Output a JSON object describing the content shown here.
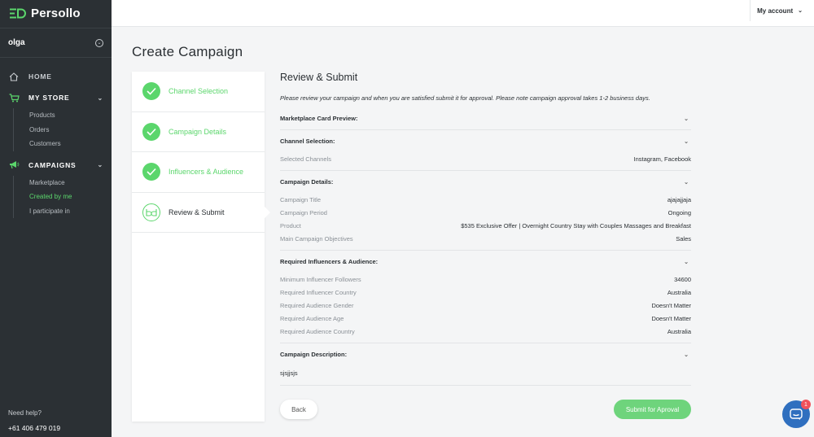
{
  "brand": {
    "name": "Persollo",
    "accent": "#5bd66c"
  },
  "user": {
    "name": "olga"
  },
  "nav": {
    "home": "HOME",
    "my_store": "MY STORE",
    "store_items": [
      "Products",
      "Orders",
      "Customers"
    ],
    "campaigns": "CAMPAIGNS",
    "campaign_items": [
      "Marketplace",
      "Created by me",
      "I participate in"
    ]
  },
  "help": {
    "label": "Need help?",
    "phone": "+61 406 479 019"
  },
  "topbar": {
    "account": "My account"
  },
  "page": {
    "title": "Create Campaign"
  },
  "steps": [
    {
      "label": "Channel Selection",
      "state": "done"
    },
    {
      "label": "Campaign Details",
      "state": "done"
    },
    {
      "label": "Influencers & Audience",
      "state": "done"
    },
    {
      "label": "Review & Submit",
      "state": "current"
    }
  ],
  "review": {
    "title": "Review & Submit",
    "instructions": "Please review your campaign and when you are satisfied submit it for approval. Please note campaign approval takes 1-2 business days.",
    "marketplace_preview": "Marketplace Card Preview:",
    "channel_selection": {
      "heading": "Channel Selection:",
      "rows": [
        {
          "label": "Selected Channels",
          "value": "Instagram, Facebook"
        }
      ]
    },
    "campaign_details": {
      "heading": "Campaign Details:",
      "rows": [
        {
          "label": "Campaign Title",
          "value": "ajajajjaja"
        },
        {
          "label": "Campaign Period",
          "value": "Ongoing"
        },
        {
          "label": "Product",
          "value": "$535 Exclusive Offer | Overnight Country Stay with Couples Massages and Breakfast"
        },
        {
          "label": "Main Campaign Objectives",
          "value": "Sales"
        }
      ]
    },
    "influencers": {
      "heading": "Required Influencers & Audience:",
      "rows": [
        {
          "label": "Minimum Influencer Followers",
          "value": "34600"
        },
        {
          "label": "Required Influencer Country",
          "value": "Australia"
        },
        {
          "label": "Required Audience Gender",
          "value": "Doesn't Matter"
        },
        {
          "label": "Required Audience Age",
          "value": "Doesn't Matter"
        },
        {
          "label": "Required Audience Country",
          "value": "Australia"
        }
      ]
    },
    "description": {
      "heading": "Campaign Description:",
      "text": "sjsjjsjs"
    },
    "back_label": "Back",
    "submit_label": "Submit for Aproval"
  },
  "chat": {
    "unread_count": "1"
  }
}
